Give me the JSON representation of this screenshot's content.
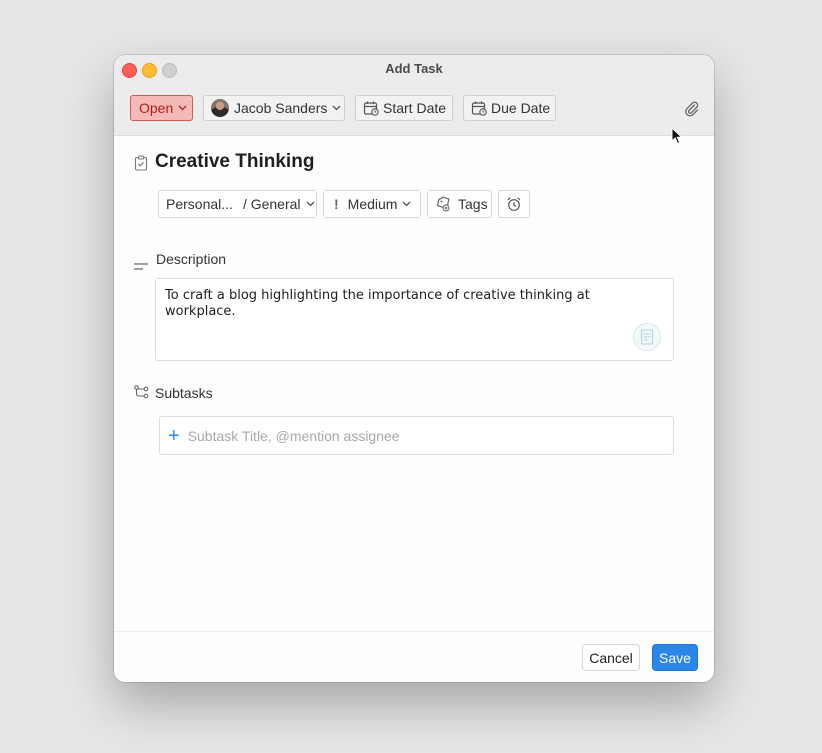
{
  "window": {
    "title": "Add Task"
  },
  "toolbar": {
    "status_label": "Open",
    "assignee_name": "Jacob Sanders",
    "start_date_label": "Start Date",
    "due_date_label": "Due Date"
  },
  "task": {
    "title": "Creative Thinking",
    "project": "Personal...",
    "category": "/ General",
    "priority_icon": "!",
    "priority": "Medium",
    "tags_label": "Tags"
  },
  "description": {
    "label": "Description",
    "text": "To craft a blog highlighting the importance of creative thinking at workplace."
  },
  "subtasks": {
    "label": "Subtasks",
    "plus": "+",
    "placeholder": "Subtask Title, @mention assignee"
  },
  "footer": {
    "cancel_label": "Cancel",
    "save_label": "Save"
  },
  "colors": {
    "status_bg": "#f5b9b7",
    "status_border": "#cf5b56",
    "status_text": "#b0201b",
    "primary": "#2a86e8"
  },
  "icons": [
    "paperclip-icon",
    "calendar-icon",
    "checklist-icon",
    "priority-icon",
    "tag-icon",
    "alarm-clock-icon",
    "lines-icon",
    "subtask-branch-icon",
    "plus-icon",
    "chevron-down-icon"
  ]
}
